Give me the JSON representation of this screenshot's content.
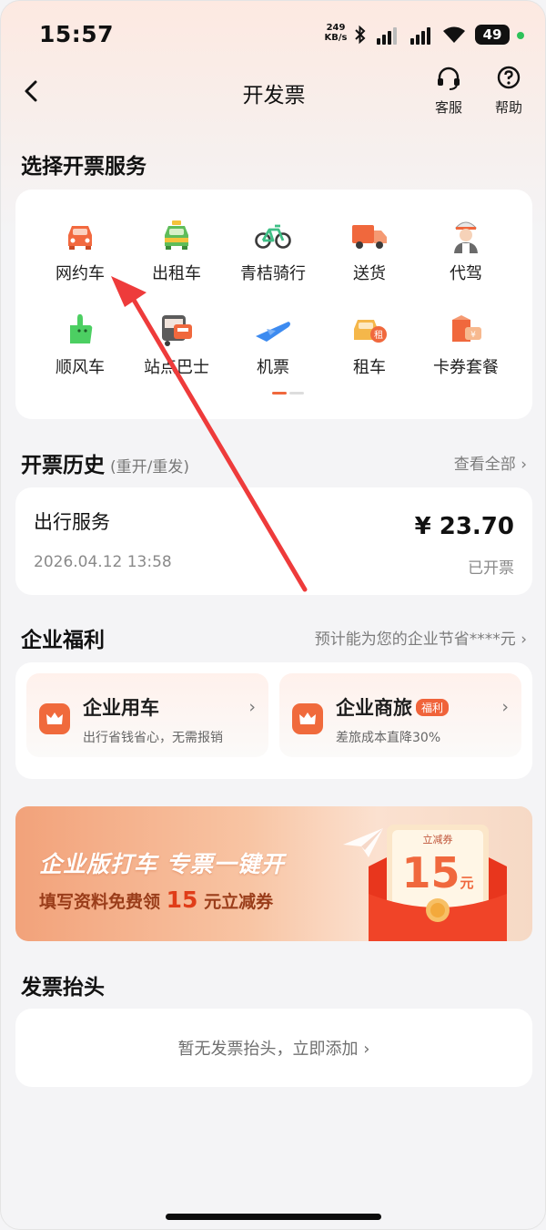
{
  "status_bar": {
    "time": "15:57",
    "net_speed_value": "249",
    "net_speed_unit": "KB/s",
    "battery": "49"
  },
  "header": {
    "title": "开发票",
    "customer_service": "客服",
    "help": "帮助"
  },
  "services": {
    "title": "选择开票服务",
    "items": [
      {
        "label": "网约车",
        "icon": "ride-hailing-car-icon"
      },
      {
        "label": "出租车",
        "icon": "taxi-icon"
      },
      {
        "label": "青桔骑行",
        "icon": "bicycle-icon"
      },
      {
        "label": "送货",
        "icon": "delivery-truck-icon"
      },
      {
        "label": "代驾",
        "icon": "designated-driver-icon"
      },
      {
        "label": "顺风车",
        "icon": "hitch-ride-icon"
      },
      {
        "label": "站点巴士",
        "icon": "bus-icon"
      },
      {
        "label": "机票",
        "icon": "airplane-icon"
      },
      {
        "label": "租车",
        "icon": "car-rental-icon"
      },
      {
        "label": "卡券套餐",
        "icon": "coupon-package-icon"
      }
    ]
  },
  "history": {
    "title": "开票历史",
    "subtitle": "(重开/重发)",
    "view_all": "查看全部",
    "record": {
      "name": "出行服务",
      "date": "2026.04.12 13:58",
      "amount": "¥ 23.70",
      "status": "已开票"
    }
  },
  "welfare": {
    "title": "企业福利",
    "savings": "预计能为您的企业节省****元",
    "cards": [
      {
        "title": "企业用车",
        "desc": "出行省钱省心，无需报销",
        "tag": ""
      },
      {
        "title": "企业商旅",
        "desc": "差旅成本直降30%",
        "tag": "福利"
      }
    ]
  },
  "banner": {
    "headline": "企业版打车 专票一键开",
    "line_prefix": "填写资料免费领",
    "amount": "15",
    "line_suffix": "元立减券",
    "coupon_label": "立减券",
    "coupon_value": "15",
    "coupon_unit": "元"
  },
  "invoice_header": {
    "title": "发票抬头",
    "empty_text": "暂无发票抬头，立即添加"
  },
  "colors": {
    "accent": "#f06a3c",
    "tag": "#f0633a",
    "arrow": "#ee3b3b"
  }
}
